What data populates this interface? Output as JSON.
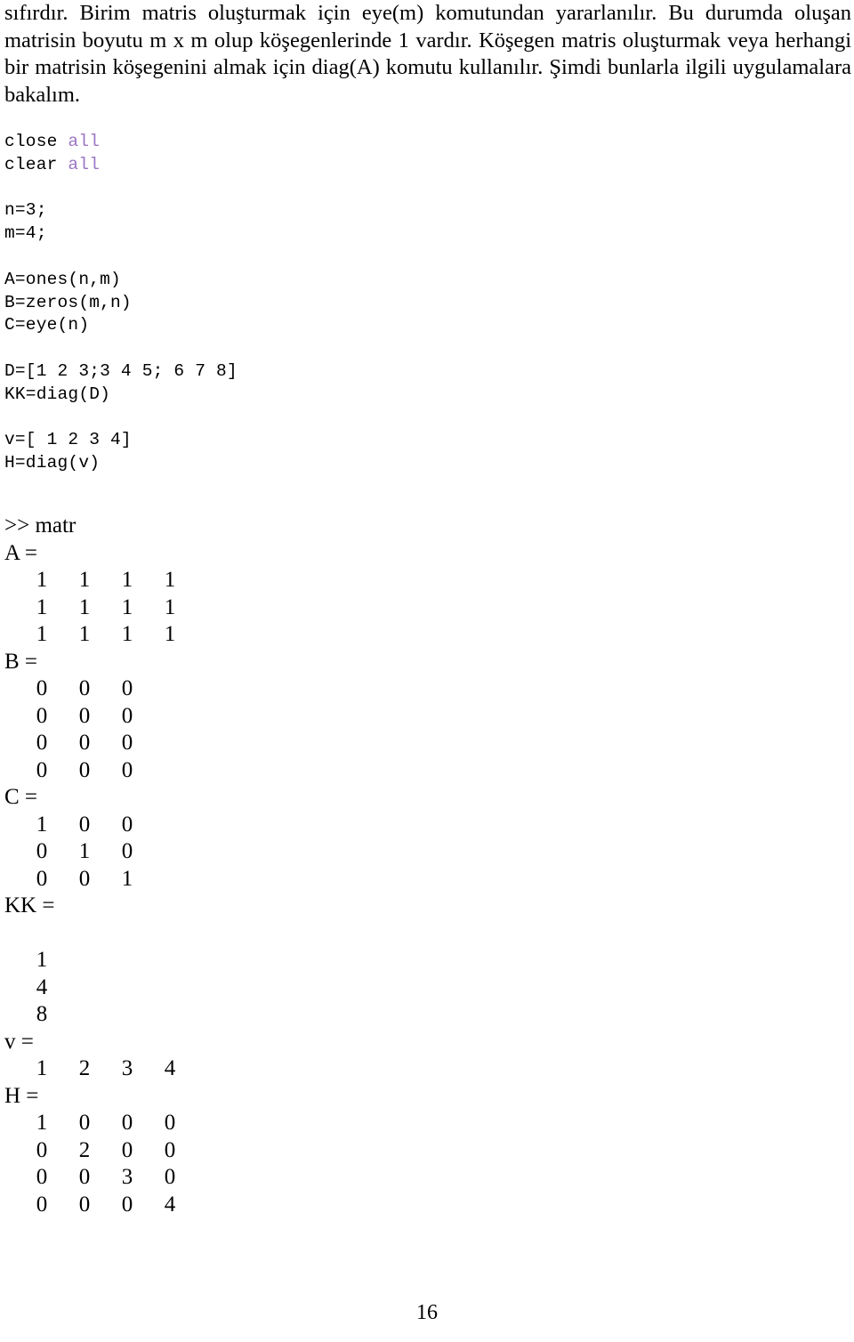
{
  "document": {
    "page_number": "16",
    "intro_paragraph": "sıfırdır. Birim matris oluşturmak için eye(m) komutundan yararlanılır. Bu durumda oluşan matrisin boyutu m x m olup köşegenlerinde 1 vardır. Köşegen matris oluşturmak veya herhangi bir matrisin köşegenini almak için diag(A) komutu kullanılır.  Şimdi bunlarla ilgili uygulamalara bakalım."
  },
  "code_block": {
    "keyword_color": "#9C76C4",
    "lines": [
      {
        "text": "close ",
        "keyword": "all"
      },
      {
        "text": "clear ",
        "keyword": "all"
      },
      {
        "text": "",
        "keyword": ""
      },
      {
        "text": "n=3;",
        "keyword": ""
      },
      {
        "text": "m=4;",
        "keyword": ""
      },
      {
        "text": "",
        "keyword": ""
      },
      {
        "text": "A=ones(n,m)",
        "keyword": ""
      },
      {
        "text": "B=zeros(m,n)",
        "keyword": ""
      },
      {
        "text": "C=eye(n)",
        "keyword": ""
      },
      {
        "text": "",
        "keyword": ""
      },
      {
        "text": "D=[1 2 3;3 4 5; 6 7 8]",
        "keyword": ""
      },
      {
        "text": "KK=diag(D)",
        "keyword": ""
      },
      {
        "text": "",
        "keyword": ""
      },
      {
        "text": "v=[ 1 2 3 4]",
        "keyword": ""
      },
      {
        "text": "H=diag(v)",
        "keyword": ""
      }
    ]
  },
  "console_output": {
    "prompt_line": ">> matr",
    "results": [
      {
        "label": "A =",
        "rows": [
          [
            "1",
            "1",
            "1",
            "1"
          ],
          [
            "1",
            "1",
            "1",
            "1"
          ],
          [
            "1",
            "1",
            "1",
            "1"
          ]
        ]
      },
      {
        "label": "B =",
        "rows": [
          [
            "0",
            "0",
            "0"
          ],
          [
            "0",
            "0",
            "0"
          ],
          [
            "0",
            "0",
            "0"
          ],
          [
            "0",
            "0",
            "0"
          ]
        ]
      },
      {
        "label": "C =",
        "rows": [
          [
            "1",
            "0",
            "0"
          ],
          [
            "0",
            "1",
            "0"
          ],
          [
            "0",
            "0",
            "1"
          ]
        ]
      },
      {
        "label": "KK =",
        "blank_before_rows": true,
        "rows": [
          [
            "1"
          ],
          [
            "4"
          ],
          [
            "8"
          ]
        ]
      },
      {
        "label": "v =",
        "rows": [
          [
            "1",
            "2",
            "3",
            "4"
          ]
        ]
      },
      {
        "label": "H =",
        "rows": [
          [
            "1",
            "0",
            "0",
            "0"
          ],
          [
            "0",
            "2",
            "0",
            "0"
          ],
          [
            "0",
            "0",
            "3",
            "0"
          ],
          [
            "0",
            "0",
            "0",
            "4"
          ]
        ]
      }
    ]
  }
}
